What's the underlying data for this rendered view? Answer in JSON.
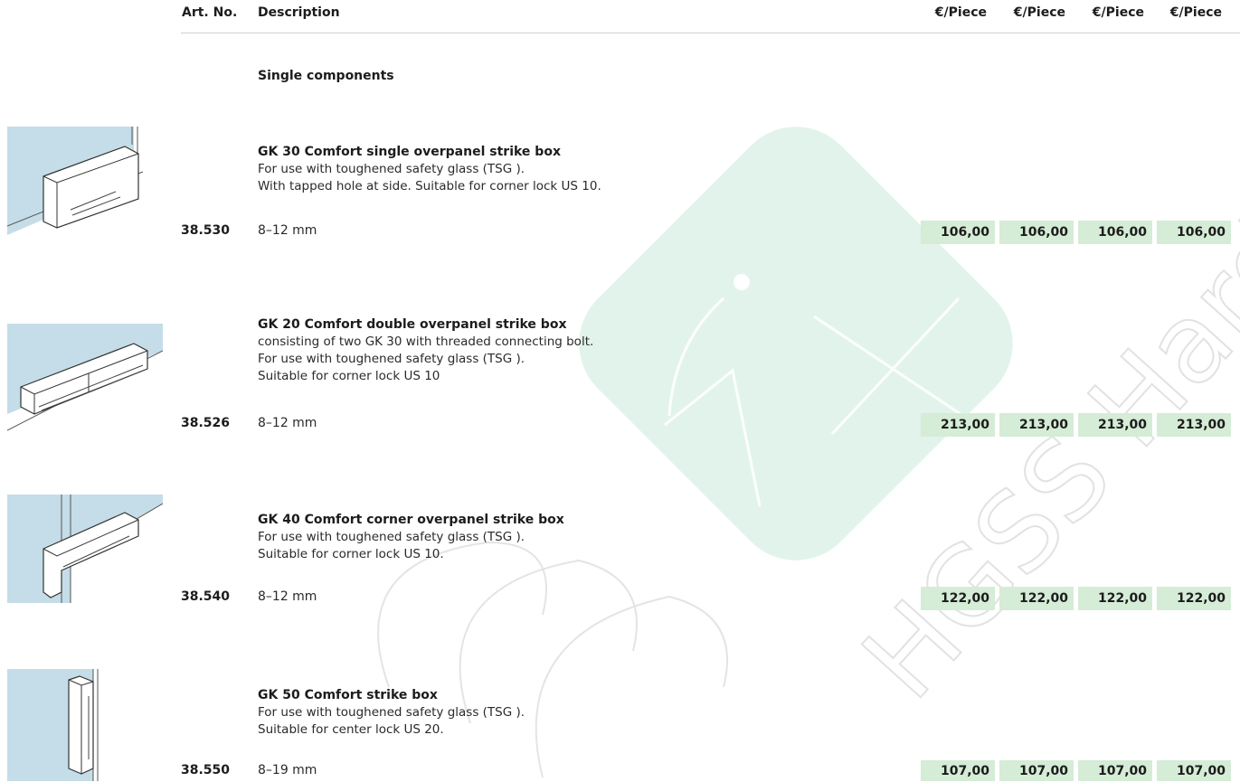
{
  "header": {
    "art_no": "Art. No.",
    "description": "Description",
    "price_cols": [
      "€/Piece",
      "€/Piece",
      "€/Piece",
      "€/Piece"
    ]
  },
  "section_title": "Single components",
  "watermark": {
    "text": "HGSS Hardware"
  },
  "products": [
    {
      "icon": "single-strike-box-thumbnail",
      "title": "GK 30 Comfort single overpanel strike box",
      "desc": [
        "For use with toughened safety glass (TSG ).",
        "With tapped hole at side. Suitable for corner lock US 10."
      ],
      "art_no": "38.530",
      "size": "8–12 mm",
      "prices": [
        "106,00",
        "106,00",
        "106,00",
        "106,00"
      ]
    },
    {
      "icon": "double-strike-box-thumbnail",
      "title": "GK 20 Comfort double overpanel strike box",
      "desc": [
        "consisting of two  GK 30 with threaded connecting bolt.",
        "For use with toughened safety glass (TSG ).",
        "Suitable for corner lock US 10"
      ],
      "art_no": "38.526",
      "size": "8–12 mm",
      "prices": [
        "213,00",
        "213,00",
        "213,00",
        "213,00"
      ]
    },
    {
      "icon": "corner-strike-box-thumbnail",
      "title": "GK 40 Comfort corner overpanel strike box",
      "desc": [
        "For use with toughened safety glass (TSG ).",
        "Suitable for corner lock US 10."
      ],
      "art_no": "38.540",
      "size": "8–12 mm",
      "prices": [
        "122,00",
        "122,00",
        "122,00",
        "122,00"
      ]
    },
    {
      "icon": "strike-box-thumbnail",
      "title": "GK 50 Comfort strike box",
      "desc": [
        "For use with toughened safety glass (TSG ).",
        "Suitable for center lock US 20."
      ],
      "art_no": "38.550",
      "size": "8–19 mm",
      "prices": [
        "107,00",
        "107,00",
        "107,00",
        "107,00"
      ]
    }
  ],
  "colors": {
    "price_bg": "#d5ecd7",
    "thumb_bg": "#c4dde8",
    "watermark": "#d8efe6"
  }
}
